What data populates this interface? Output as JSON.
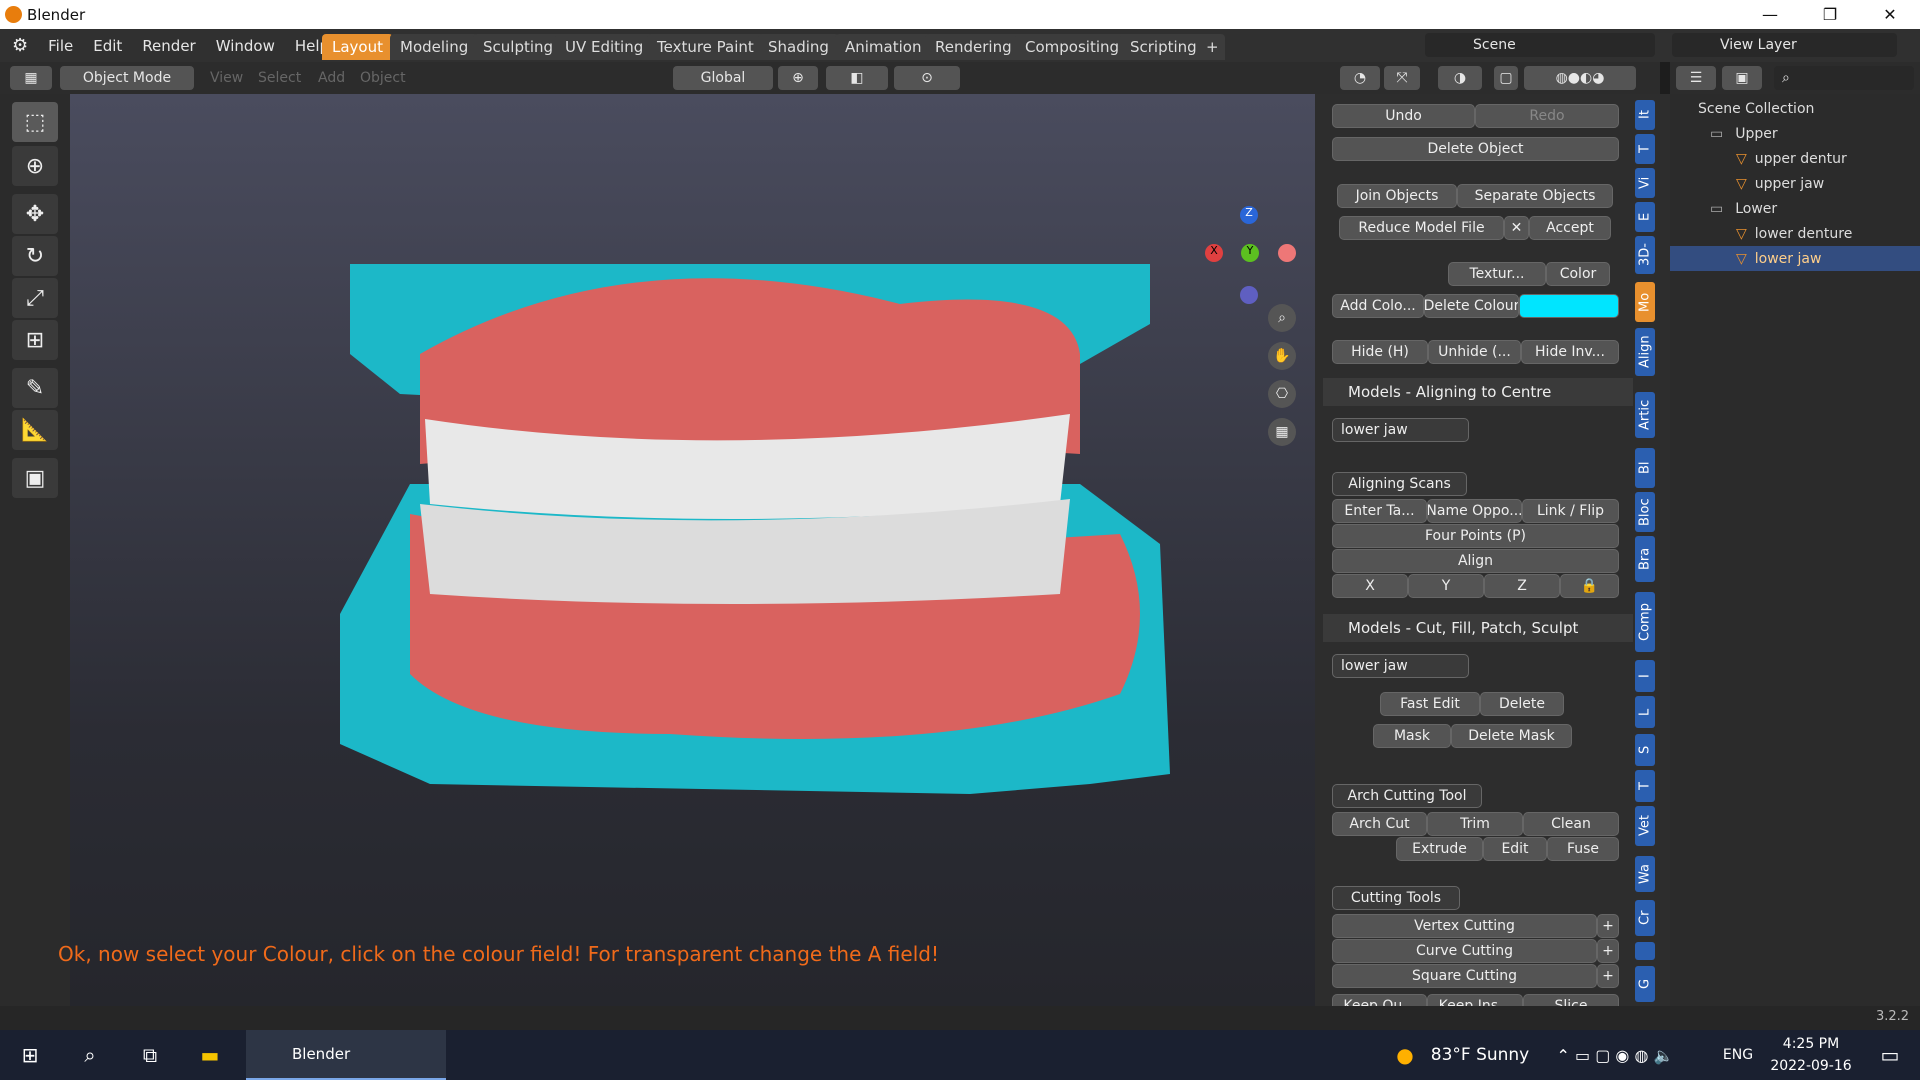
{
  "app": {
    "title": "Blender",
    "version": "3.2.2"
  },
  "menu": [
    "File",
    "Edit",
    "Render",
    "Window",
    "Help"
  ],
  "workspaces": [
    "Layout",
    "Modeling",
    "Sculpting",
    "UV Editing",
    "Texture Paint",
    "Shading",
    "Animation",
    "Rendering",
    "Compositing",
    "Scripting"
  ],
  "scene": {
    "label": "Scene"
  },
  "view_layer": {
    "label": "View Layer"
  },
  "header": {
    "mode": "Object Mode",
    "menus": [
      "View",
      "Select",
      "Add",
      "Object"
    ],
    "orientation": "Global"
  },
  "viewport": {
    "hint": "Ok, now select your Colour, click on the colour field! For transparent change the A field!",
    "gizmo": {
      "x": "X",
      "y": "Y",
      "z": "Z"
    }
  },
  "panel": {
    "undo": "Undo",
    "redo": "Redo",
    "delete_object": "Delete Object",
    "join": "Join Objects",
    "separate": "Separate Objects",
    "reduce": "Reduce Model File",
    "accept": "Accept",
    "texture": "Textur...",
    "color": "Color",
    "add_colour": "Add Colo...",
    "delete_colour": "Delete Colour",
    "swatch": "#00e5ff",
    "hide": "Hide (H)",
    "unhide": "Unhide (...",
    "hide_inv": "Hide Inv...",
    "sec1_title": "Models - Aligning to Centre",
    "sec1_field": "lower jaw",
    "aligning_scans": "Aligning Scans",
    "enter_ta": "Enter Ta...",
    "name_oppo": "Name Oppo...",
    "link_flip": "Link / Flip",
    "four_points": "Four Points (P)",
    "align": "Align",
    "ax_x": "X",
    "ax_y": "Y",
    "ax_z": "Z",
    "sec2_title": "Models - Cut, Fill, Patch, Sculpt",
    "sec2_field": "lower jaw",
    "fast_edit": "Fast Edit",
    "delete": "Delete",
    "mask": "Mask",
    "delete_mask": "Delete Mask",
    "arch_tool": "Arch Cutting Tool",
    "arch_cut": "Arch Cut",
    "trim": "Trim",
    "clean": "Clean",
    "extrude": "Extrude",
    "edit": "Edit",
    "fuse": "Fuse",
    "cutting_tools": "Cutting Tools",
    "vertex": "Vertex Cutting",
    "curve": "Curve Cutting",
    "square": "Square Cutting",
    "keep_out": "Keep Ou...",
    "keep_ins": "Keep Ins...",
    "slice": "Slice"
  },
  "side_tabs": [
    "It",
    "T",
    "Vi",
    "E",
    "3D-",
    "Mo",
    "Align",
    "Artic",
    "Bl",
    "Bloc",
    "Bra",
    "Comp",
    "I",
    "L",
    "S",
    "T",
    "Vet",
    "Wa",
    "Cr",
    "",
    "G"
  ],
  "outliner": {
    "root": "Scene Collection",
    "rows": [
      {
        "label": "Upper",
        "type": "collection",
        "depth": 1
      },
      {
        "label": "upper dentur",
        "type": "mesh",
        "depth": 2
      },
      {
        "label": "upper jaw",
        "type": "mesh",
        "depth": 2
      },
      {
        "label": "Lower",
        "type": "collection",
        "depth": 1
      },
      {
        "label": "lower denture",
        "type": "mesh",
        "depth": 2
      },
      {
        "label": "lower jaw",
        "type": "mesh",
        "depth": 2,
        "selected": true
      }
    ]
  },
  "taskbar": {
    "app": "Blender",
    "weather": "83°F  Sunny",
    "lang": "ENG",
    "time": "4:25 PM",
    "date": "2022-09-16"
  }
}
